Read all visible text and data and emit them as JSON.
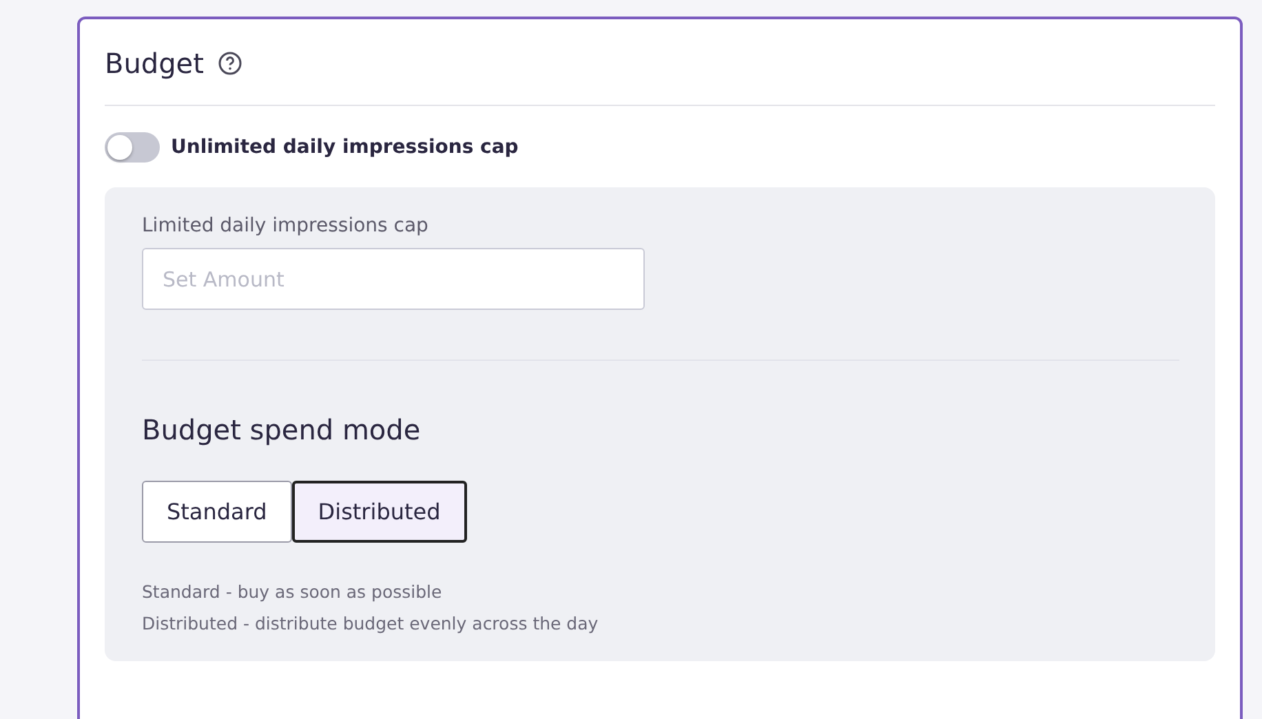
{
  "card": {
    "title": "Budget",
    "unlimited_toggle": {
      "label": "Unlimited daily impressions cap",
      "on": false
    },
    "cap_field": {
      "label": "Limited daily impressions cap",
      "placeholder": "Set Amount"
    },
    "spend_mode": {
      "title": "Budget spend mode",
      "options": [
        {
          "label": "Standard",
          "selected": false
        },
        {
          "label": "Distributed",
          "selected": true
        }
      ],
      "notes": [
        "Standard - buy as soon as possible",
        "Distributed - distribute budget evenly across the day"
      ]
    }
  }
}
